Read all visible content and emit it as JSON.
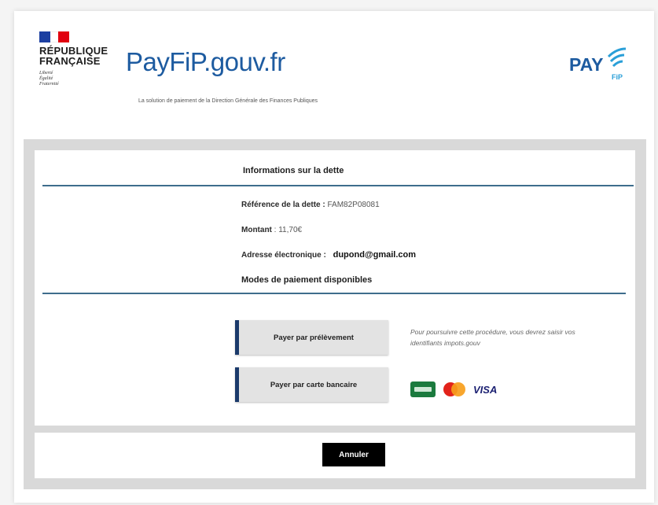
{
  "header": {
    "republique": [
      "RÉPUBLIQUE",
      "FRANÇAISE"
    ],
    "devise": [
      "Liberté",
      "Égalité",
      "Fraternité"
    ],
    "site_name": "PayFiP.gouv.fr",
    "tagline": "La solution de paiement de la Direction Générale des Finances Publiques",
    "logo_text": "PAY",
    "logo_sub": "FiP"
  },
  "debt": {
    "title": "Informations sur la dette",
    "ref_label": "Référence de la dette :",
    "ref_value": "FAM82P08081",
    "amount_label": "Montant",
    "amount_value": ": 11,70€",
    "email_label": "Adresse électronique :",
    "email_value": "dupond@gmail.com"
  },
  "payment": {
    "title": "Modes de paiement disponibles",
    "debit_button": "Payer par prélèvement",
    "debit_note": "Pour poursuivre cette procédure, vous devrez saisir vos identifiants impots.gouv",
    "card_button": "Payer par carte bancaire",
    "visa": "VISA"
  },
  "footer": {
    "cancel_button": "Annuler"
  },
  "colors": {
    "brand_blue": "#1d5ba0",
    "button_accent": "#1b3a6b",
    "rule": "#3e6d8c"
  }
}
